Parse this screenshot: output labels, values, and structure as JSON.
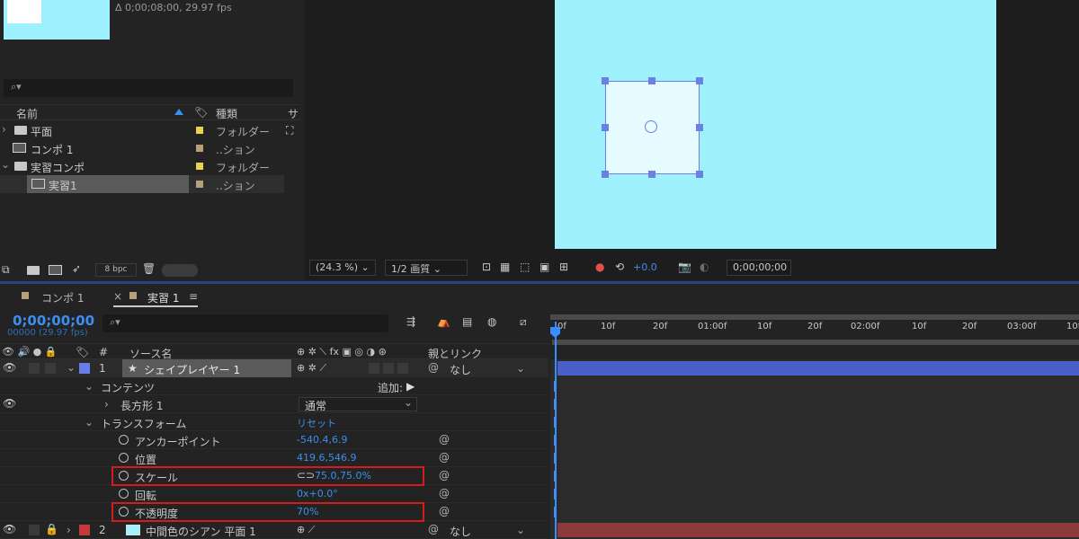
{
  "project": {
    "info": "Δ 0;00;08;00, 29.97 fps",
    "columns": {
      "name": "名前",
      "type": "種類",
      "size": "サ"
    },
    "items": [
      {
        "name": "平面",
        "type": "フォルダー",
        "label_color": "#e6d24c",
        "icon": "folder-icon",
        "expanded": false,
        "indent": 0
      },
      {
        "name": "コンポ 1",
        "type": "..ション",
        "label_color": "#b8a07a",
        "icon": "composition-icon",
        "indent": 0
      },
      {
        "name": "実習コンポ",
        "type": "フォルダー",
        "label_color": "#e6d24c",
        "icon": "folder-icon",
        "expanded": true,
        "indent": 0
      },
      {
        "name": "実習1",
        "type": "..ション",
        "label_color": "#b8a07a",
        "icon": "composition-icon",
        "indent": 1,
        "selected": true
      }
    ],
    "footer_bpc": "8 bpc"
  },
  "viewer": {
    "zoom": "(24.3 %)",
    "resolution": "1/2 画質",
    "exposure": "+0.0",
    "timecode": "0;00;00;00"
  },
  "timeline": {
    "tabs": [
      {
        "label": "コンポ 1",
        "active": false
      },
      {
        "label": "実習 1",
        "active": true
      }
    ],
    "timecode": "0;00;00;00",
    "timecode_sub": "00000 (29.97 fps)",
    "columns": {
      "num": "#",
      "source": "ソース名",
      "parent": "親とリンク"
    },
    "ruler_ticks": [
      "0f",
      "10f",
      "20f",
      "01:00f",
      "10f",
      "20f",
      "02:00f",
      "10f",
      "20f",
      "03:00f",
      "10f"
    ],
    "layers": [
      {
        "num": "1",
        "name": "シェイプレイヤー 1",
        "color": "#6a7fe6",
        "parent": "なし",
        "bar_color": "#4a5fc8"
      },
      {
        "num": "2",
        "name": "中間色のシアン 平面 1",
        "color": "#c23a3a",
        "parent": "なし",
        "bar_color": "#8a3a3a"
      }
    ],
    "props": {
      "contents": "コンテンツ",
      "add": "追加:",
      "rect": "長方形 1",
      "blend": "通常",
      "transform": "トランスフォーム",
      "reset": "リセット",
      "anchor": {
        "label": "アンカーポイント",
        "value": "-540.4,6.9"
      },
      "position": {
        "label": "位置",
        "value": "419.6,546.9"
      },
      "scale": {
        "label": "スケール",
        "value": "75.0,75.0%"
      },
      "rotation": {
        "label": "回転",
        "value": "0x+0.0°"
      },
      "opacity": {
        "label": "不透明度",
        "value": "70%"
      }
    }
  }
}
